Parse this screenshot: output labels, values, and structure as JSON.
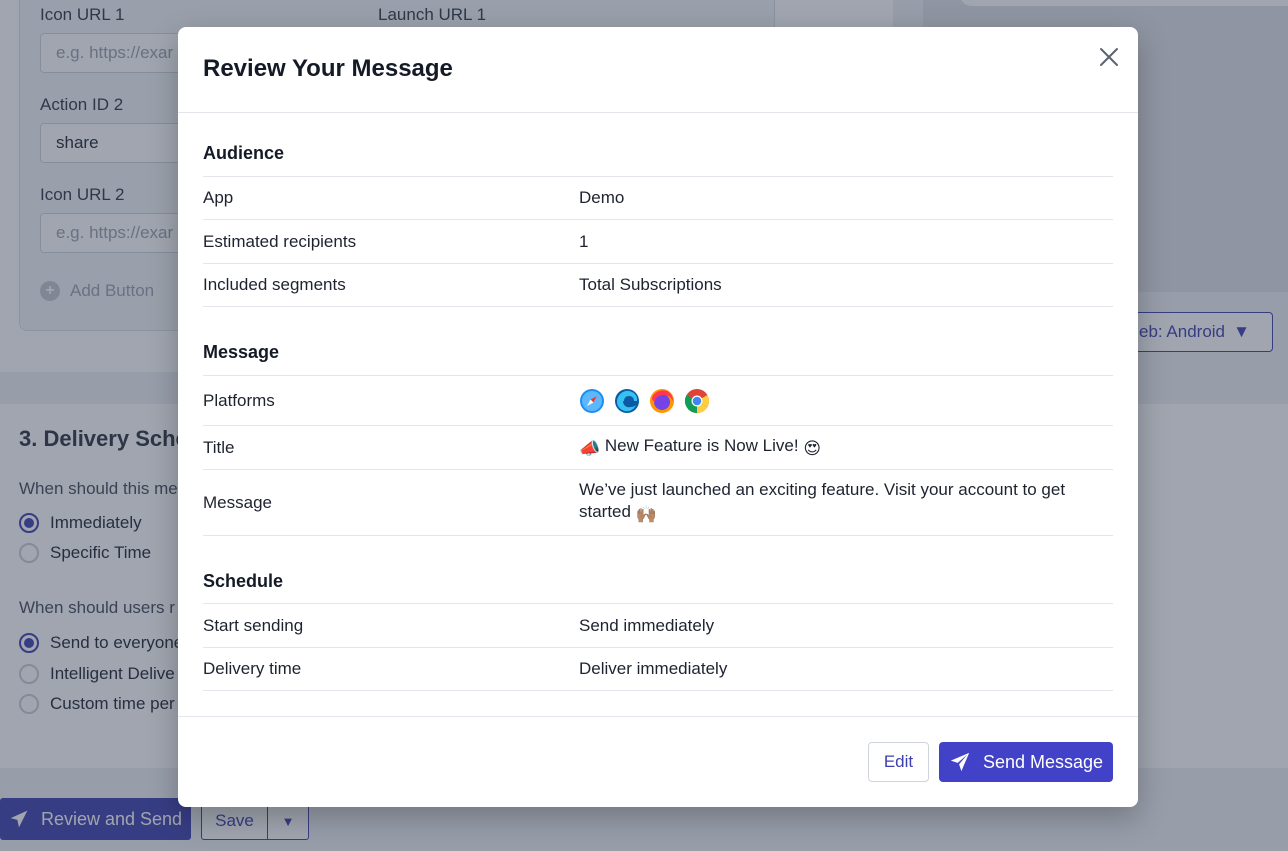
{
  "background": {
    "fields": {
      "icon_url_1_label": "Icon URL 1",
      "launch_url_1_label": "Launch URL 1",
      "icon_url_1_placeholder": "e.g. https://exar",
      "action_id_2_label": "Action ID 2",
      "action_id_2_value": "share",
      "icon_url_2_label": "Icon URL 2",
      "icon_url_2_placeholder": "e.g. https://exar",
      "add_button_label": "Add Button"
    },
    "delivery": {
      "section_title": "3. Delivery Sche",
      "question_1": "When should this me",
      "option_immediately": "Immediately",
      "option_specific_time": "Specific Time",
      "question_2": "When should users r",
      "option_send_everyone": "Send to everyone",
      "option_intelligent": "Intelligent Delive",
      "option_custom": "Custom time per"
    },
    "preview_select_label": "eb: Android",
    "review_and_send_label": "Review and Send",
    "save_label": "Save"
  },
  "modal": {
    "title": "Review Your Message",
    "sections": {
      "audience": {
        "title": "Audience",
        "rows": [
          {
            "key": "App",
            "value": "Demo"
          },
          {
            "key": "Estimated recipients",
            "value": "1"
          },
          {
            "key": "Included segments",
            "value": "Total Subscriptions"
          }
        ]
      },
      "message": {
        "title": "Message",
        "platforms_label": "Platforms",
        "platform_icons": [
          "safari-icon",
          "edge-icon",
          "firefox-icon",
          "chrome-icon"
        ],
        "title_label": "Title",
        "title_prefix_emoji": "📣",
        "title_text": "New Feature is Now Live!",
        "title_suffix_emoji": "😍",
        "message_label": "Message",
        "message_text": "We’ve just launched an exciting feature. Visit your account to get started",
        "message_emoji": "🙌🏽"
      },
      "schedule": {
        "title": "Schedule",
        "rows": [
          {
            "key": "Start sending",
            "value": "Send immediately"
          },
          {
            "key": "Delivery time",
            "value": "Deliver immediately"
          }
        ]
      }
    },
    "footer": {
      "edit_label": "Edit",
      "send_label": "Send Message"
    }
  },
  "colors": {
    "accent": "#4142c8",
    "overlay": "rgba(48,58,80,0.46)"
  }
}
